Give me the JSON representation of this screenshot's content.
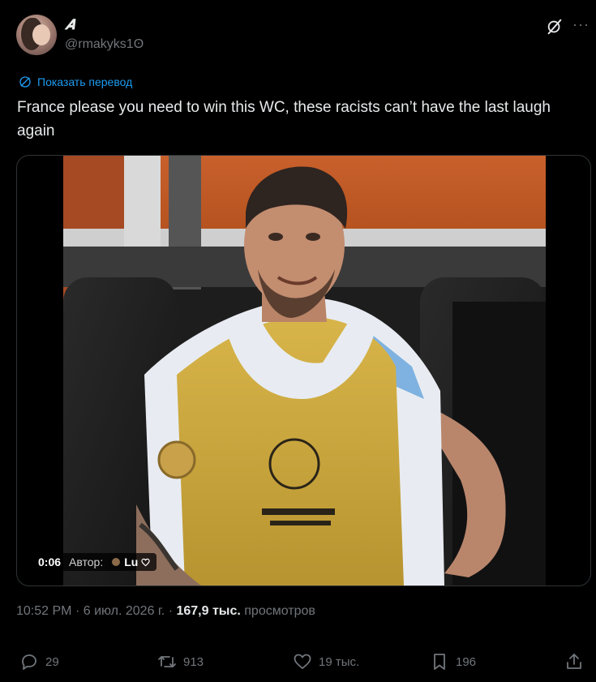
{
  "user": {
    "display_name": "𝑨",
    "handle": "@rmakyks1ʘ"
  },
  "header_icons": [
    "grok-icon",
    "more-icon"
  ],
  "more_label": "···",
  "translate": {
    "label": "Показать перевод",
    "icon": "globe-icon"
  },
  "tweet": {
    "text": "France please you need to win this WC,  these racists can’t have the last laugh again"
  },
  "media": {
    "duration": "0:06",
    "author_label": "Автор:",
    "author_name": "Lu"
  },
  "meta": {
    "time": "10:52 PM",
    "date": "6 июл. 2026 г.",
    "views": "167,9 тыс.",
    "views_label": "просмотров"
  },
  "actions": {
    "replies": "29",
    "reposts": "913",
    "likes": "19 тыс.",
    "bookmarks": "196"
  },
  "colors": {
    "accent": "#1d9bf0",
    "muted": "#71767b",
    "text": "#e7e9ea",
    "bg": "#000000"
  }
}
